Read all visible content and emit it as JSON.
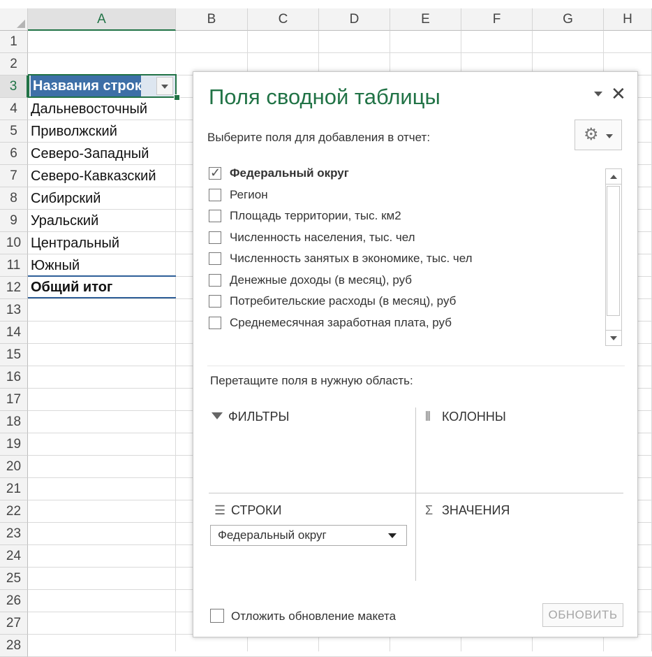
{
  "columns": [
    "A",
    "B",
    "C",
    "D",
    "E",
    "F",
    "G",
    "H"
  ],
  "rows": [
    "1",
    "2",
    "3",
    "4",
    "5",
    "6",
    "7",
    "8",
    "9",
    "10",
    "11",
    "12",
    "13",
    "14",
    "15",
    "16",
    "17",
    "18",
    "19",
    "20",
    "21",
    "22",
    "23",
    "24",
    "25",
    "26",
    "27",
    "28"
  ],
  "pivot": {
    "header_label": "Названия строк",
    "items": [
      "Дальневосточный",
      "Приволжский",
      "Северо-Западный",
      "Северо-Кавказский",
      "Сибирский",
      "Уральский",
      "Центральный",
      "Южный"
    ],
    "total_label": "Общий итог"
  },
  "pane": {
    "title": "Поля сводной таблицы",
    "close_glyph": "✕",
    "prompt": "Выберите поля для добавления в отчет:",
    "gear_glyph": "⚙",
    "fields": [
      {
        "label": "Федеральный округ",
        "checked": true
      },
      {
        "label": "Регион",
        "checked": false
      },
      {
        "label": "Площадь территории, тыс. км2",
        "checked": false
      },
      {
        "label": "Численность населения, тыс. чел",
        "checked": false
      },
      {
        "label": "Численность занятых в экономике, тыс. чел",
        "checked": false
      },
      {
        "label": "Денежные доходы (в месяц), руб",
        "checked": false
      },
      {
        "label": "Потребительские расходы (в месяц), руб",
        "checked": false
      },
      {
        "label": "Среднемесячная заработная плата, руб",
        "checked": false
      }
    ],
    "check_glyph": "✓",
    "drag_prompt": "Перетащите поля в нужную область:",
    "zones": {
      "filters": {
        "label": "ФИЛЬТРЫ"
      },
      "columns": {
        "label": "КОЛОННЫ",
        "icon": "⦀"
      },
      "rows": {
        "label": "СТРОКИ",
        "icon": "☰"
      },
      "values": {
        "label": "ЗНАЧЕНИЯ",
        "icon": "Σ"
      }
    },
    "row_field": "Федеральный округ",
    "defer_label": "Отложить обновление макета",
    "update_button": "ОБНОВИТЬ"
  },
  "colors": {
    "excel_green": "#217346",
    "pivot_header_blue": "#3d6fa7"
  }
}
